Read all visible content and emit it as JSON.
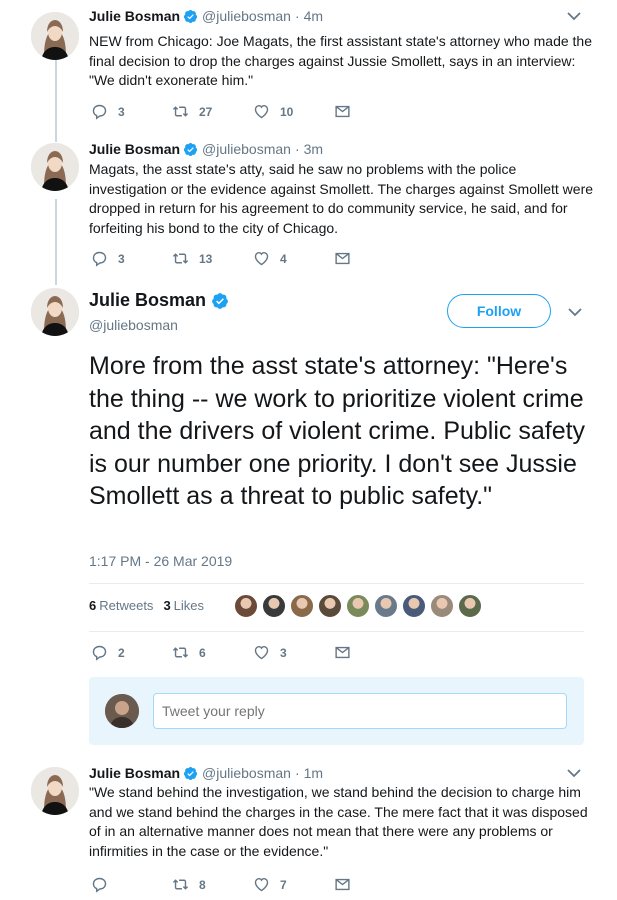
{
  "author": {
    "name": "Julie Bosman",
    "handle": "@juliebosman"
  },
  "colors": {
    "accent": "#1da1f2",
    "muted": "#657786",
    "text": "#14171a",
    "divider": "#e6ecf0"
  },
  "tweets": [
    {
      "time": "4m",
      "text": "NEW from Chicago: Joe Magats, the first assistant state's attorney who made the final decision to drop the charges against Jussie Smollett, says in an interview: \"We didn't exonerate him.\"",
      "replies": "3",
      "retweets": "27",
      "likes": "10"
    },
    {
      "time": "3m",
      "text": "Magats, the asst state's atty, said he saw no problems with the police investigation or the evidence against Smollett. The charges against Smollett were dropped in return for his agreement to do community service, he said, and for forfeiting his bond to the city of Chicago.",
      "replies": "3",
      "retweets": "13",
      "likes": "4"
    }
  ],
  "focused": {
    "follow_label": "Follow",
    "text": "More from the asst state's attorney: \"Here's the thing -- we work to prioritize violent crime and the drivers of violent crime. Public safety is our number one priority. I don't see Jussie Smollett as a threat to public safety.\"",
    "timestamp": "1:17 PM - 26 Mar 2019",
    "retweet_count": "6",
    "retweet_label": "Retweets",
    "like_count": "3",
    "like_label": "Likes",
    "replies": "2",
    "retweets": "6",
    "likes": "3",
    "likers": [
      "#6b4a3a",
      "#3a3a3a",
      "#8a6a4a",
      "#5a4a3a",
      "#7a8a5a",
      "#6a7a8a",
      "#4a5a7a",
      "#9a8a7a",
      "#5a6a4a"
    ]
  },
  "reply": {
    "placeholder": "Tweet your reply"
  },
  "last_tweet": {
    "time": "1m",
    "text": "\"We stand behind the investigation, we stand behind the decision to charge him and we stand behind the charges in the case. The mere fact that it was disposed of in an alternative manner does not mean that there were any problems or infirmities in the case or the evidence.\"",
    "replies": "",
    "retweets": "8",
    "likes": "7"
  },
  "icons": {
    "verified": "verified-badge-icon",
    "reply": "reply-icon",
    "retweet": "retweet-icon",
    "like": "heart-icon",
    "dm": "envelope-icon",
    "more": "chevron-down-icon"
  }
}
